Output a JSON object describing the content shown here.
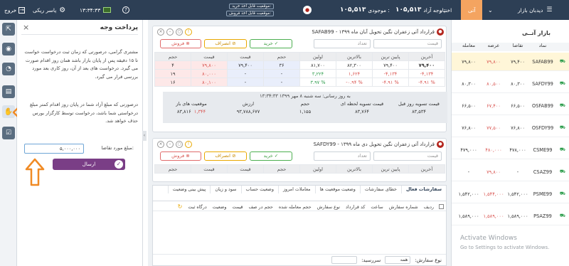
{
  "topbar": {
    "exit": "خروج",
    "user": "یاسر ریکی",
    "clock": "۱۳:۳۴:۳۳",
    "username": "دیدبان بازار",
    "tab_active": "آتی",
    "tab_option": "اختیار",
    "cash_label": "وجه آزاد :",
    "cash_value": "۱۰۵,۵۱۳",
    "balance_label": "موجودی :",
    "balance_value": "۱۰۵,۵۱۳",
    "position_buy": "موقعیت قابل اخذ خرید:",
    "position_sell": "موقعیت قابل اخذ فروش:"
  },
  "payment": {
    "title": "پرداخت وجه",
    "para1": "مشتری گرامی، درصورتی که زمان ثبت درخواست خواست تا ۱۵ دقیقه پس از پایان بازار باشد همان روز اقدام صورت می گیرد. درخواست های بعد از آن، روز کاری بعد مورد بررسی قرار می گیرد.",
    "para2": "درصورتی که مبلغ آزاد شما در پایان روز اقدام کمتر مبلغ درخواستی شما باشد، درخواست توسط کارگزار بورس حذف خواهد شد.",
    "amount_label": "مبلغ مورد تقاضا:",
    "amount_value": "۵,۰۰۰,۰۰۰",
    "send_button": "ارسال"
  },
  "cards": [
    {
      "title": "SAFAB99 - قرارداد آتی زعفران نگین تحویل آبان ماه ۱۳۹۹",
      "sell": "فروش",
      "cancel": "انصراف",
      "buy": "خرید",
      "price_placeholder": "قیمت",
      "qty_placeholder": "تعداد",
      "book_header": [
        "حجم",
        "قیمت",
        "قیمت",
        "حجم"
      ],
      "book_rows": [
        [
          "۳۶",
          "۷۹,۴۰۰",
          "۷۹,۸۰۰",
          "۴"
        ],
        [
          "-",
          "-",
          "۸۰,۰۰۰",
          "۱۹"
        ],
        [
          "-",
          "-",
          "۸۰,۱۰۰",
          "۱۶"
        ]
      ],
      "info_header": [
        "اولین",
        "بالاترین",
        "پایین ترین",
        "آخرین"
      ],
      "info_rows": [
        [
          "۸۱,۷۰۰",
          "۸۲,۳۰۰",
          "۷۹,۴۰۰",
          "۷۹,۴۰۰"
        ],
        [
          "۳,۲۲۴",
          "۱,۶۲۴",
          "-۴,۱۳۴",
          "-۴,۱۳۴"
        ],
        [
          "۳.۹۷ %",
          "-۰.۹۴ %",
          "-۴.۹۱ %",
          "-۴.۹۱ %"
        ]
      ],
      "settlement_time": "به روز رسانی: سه شنبه ۸ مهر ۱۳۹۹ ۱۳:۳۴:۳۳",
      "stats_header": [
        "قیمت تسویه روز قبل",
        "قیمت تسویه لحظه ای",
        "حجم",
        "ارزش",
        "موقعیت های باز"
      ],
      "stats_row": [
        "۸۳,۵۳۴",
        "۸۳,۷۶۴",
        "۱,۱۵۵",
        "۹۳,۷۸۸,۶۷۷",
        "۸۳,۸۱۶"
      ],
      "stats_extra": "۱,۳۴۴"
    },
    {
      "title": "SAFDY99 - قرارداد آتی زعفران نگین تحویل دی ماه ۱۳۹۹",
      "sell": "فروش",
      "cancel": "انصراف",
      "buy": "خرید",
      "price_placeholder": "قیمت",
      "qty_placeholder": "تعداد",
      "book_header": [
        "حجم",
        "قیمت",
        "قیمت",
        "حجم"
      ],
      "info_header": [
        "اولین",
        "بالاترین",
        "پایین ترین",
        "آخرین"
      ]
    }
  ],
  "orders": {
    "tabs": [
      "سفارشات فعال",
      "خطای سفارشات",
      "وضعیت موقعیت ها",
      "معاملات امروز",
      "وضعیت حساب",
      "سود و زیان",
      "پیش بینی وضعیت"
    ],
    "columns": [
      "ردیف",
      "شماره سفارش",
      "ساعت",
      "کد قرارداد",
      "نوع سفارش",
      "حجم معامله شده",
      "حجم در صف",
      "قیمت",
      "وضعیت",
      "درگاه ثبت"
    ],
    "footer_type": "نوع سفارش:",
    "footer_type_value": "همه",
    "footer_due": "سررسید:"
  },
  "market": {
    "title": "بازار آتــی",
    "columns": [
      "نماد",
      "معامله",
      "عرضه",
      "تقاضا"
    ],
    "rows": [
      [
        "SAFAB99",
        "۷۹,۸۰۰",
        "۷۹,۸۰۰",
        "۷۹,۴۰۰"
      ],
      [
        "SAFDY99",
        "۸۰,۳۰۰",
        "۸۰,۵۰۰",
        "۸۰,۳۰۰"
      ],
      [
        "OSFAB99",
        "۶۶,۵۰۰",
        "۶۷,۴۰۰",
        "۶۶,۵۰۰"
      ],
      [
        "OSFDY99",
        "۷۶,۸۰۰",
        "۷۷,۵۰۰",
        "۷۶,۸۰۰"
      ],
      [
        "CSME99",
        "۴۷۹,۰۰۰",
        "۴۸۰,۰۰۰",
        "۴۷۸,۰۰۰"
      ],
      [
        "CSAZ99",
        "-",
        "۷۹,۸۰۰",
        "-"
      ],
      [
        "PSME99",
        "۱,۵۴۲,۰۰۰",
        "۱,۵۴۴,۰۰۰",
        "۱,۵۴۲,۰۰۰"
      ],
      [
        "PSAZ99",
        "۱,۵۸۹,۰۰۰",
        "۱,۵۸۹,۰۰۰",
        "۱,۵۸۹,۰۰۰"
      ]
    ],
    "watermark_1": "Activate Windows",
    "watermark_2": "Go to Settings to activate Windows."
  },
  "colors": {
    "header_bg": "#2d3f55",
    "accent": "#f4a460",
    "send_button": "#7a3e86",
    "sell": "#d9534f",
    "buy": "#2e9d4d"
  }
}
